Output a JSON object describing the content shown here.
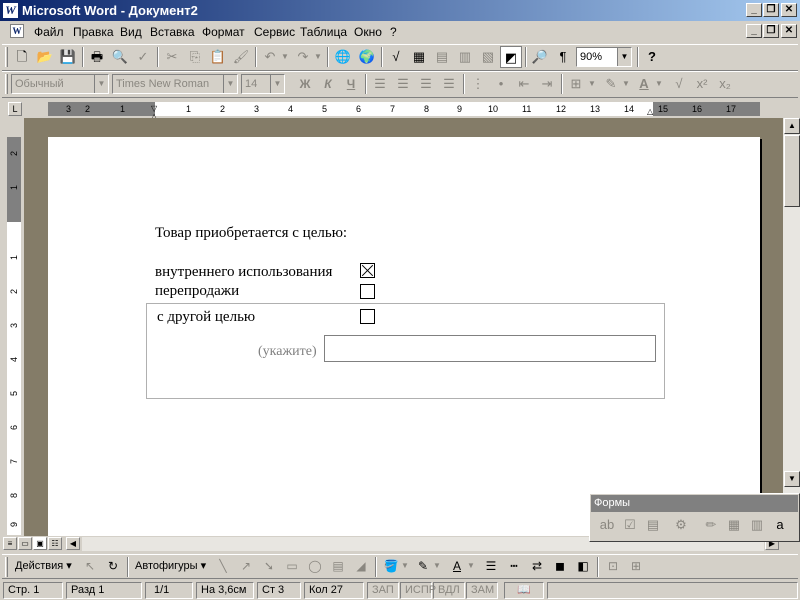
{
  "window": {
    "title": "Microsoft Word - Документ2",
    "app_icon": "W",
    "doc_icon": "W",
    "minimize": "_",
    "restore": "❐",
    "close": "✕"
  },
  "menu": [
    {
      "label": "Файл"
    },
    {
      "label": "Правка"
    },
    {
      "label": "Вид"
    },
    {
      "label": "Вставка"
    },
    {
      "label": "Формат"
    },
    {
      "label": "Сервис"
    },
    {
      "label": "Таблица"
    },
    {
      "label": "Окно"
    },
    {
      "label": "?"
    }
  ],
  "standard_toolbar": {
    "zoom": "90%"
  },
  "format_toolbar": {
    "style": "Обычный",
    "font": "Times New Roman",
    "size": "14"
  },
  "ruler": {
    "corner": "L",
    "h_numbers": [
      "3",
      "2",
      "1",
      "1",
      "2",
      "3",
      "4",
      "5",
      "6",
      "7",
      "8",
      "9",
      "10",
      "11",
      "12",
      "13",
      "14",
      "15",
      "16",
      "17"
    ],
    "v_numbers": [
      "2",
      "1",
      "1",
      "2",
      "3",
      "4",
      "5",
      "6",
      "7",
      "8",
      "9"
    ]
  },
  "document": {
    "question": "Товар приобретается с целью:",
    "options": [
      {
        "label": "внутреннего использования",
        "checked": true
      },
      {
        "label": "перепродажи",
        "checked": false
      },
      {
        "label": "с другой целью",
        "checked": false
      }
    ],
    "specify_label": "(укажите)",
    "specify_value": ""
  },
  "forms_toolbar": {
    "title": "Формы"
  },
  "drawing_toolbar": {
    "actions": "Действия",
    "autoshapes": "Автофигуры"
  },
  "status": {
    "page": "Стр. 1",
    "section": "Разд 1",
    "pages": "1/1",
    "at": "На 3,6см",
    "line": "Ст 3",
    "col": "Кол 27",
    "rec": "ЗАП",
    "trk": "ИСПР",
    "ext": "ВДЛ",
    "ovr": "ЗАМ"
  }
}
